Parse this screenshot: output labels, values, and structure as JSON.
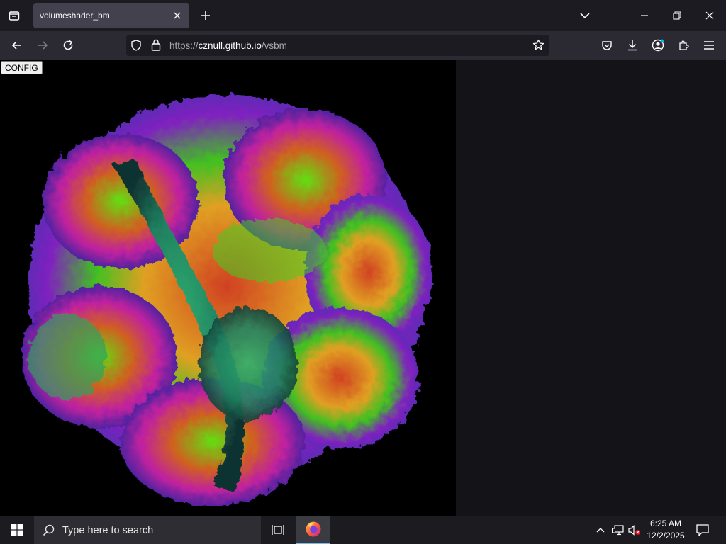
{
  "browser": {
    "tab": {
      "title": "volumeshader_bm"
    },
    "url": {
      "scheme": "https://",
      "host": "cznull.github.io",
      "path": "/vsbm"
    }
  },
  "page": {
    "config_label": "CONFIG"
  },
  "taskbar": {
    "search_placeholder": "Type here to search",
    "time": "6:25 AM",
    "date": "12/2/2025"
  },
  "colors": {
    "accent": "#76b9ed",
    "browser_chrome": "#2b2a33",
    "tab_active": "#42414d",
    "canvas_bg": "#000000"
  },
  "icons": [
    "tab-list-icon",
    "close-icon",
    "plus-icon",
    "chevron-down-icon",
    "minimize-icon",
    "restore-icon",
    "window-close-icon",
    "back-icon",
    "forward-icon",
    "reload-icon",
    "shield-icon",
    "lock-icon",
    "star-icon",
    "pocket-icon",
    "download-icon",
    "account-icon",
    "extensions-icon",
    "menu-icon",
    "windows-logo-icon",
    "search-icon",
    "task-view-icon",
    "firefox-icon",
    "chevron-up-icon",
    "network-icon",
    "volume-muted-icon",
    "notification-icon"
  ]
}
